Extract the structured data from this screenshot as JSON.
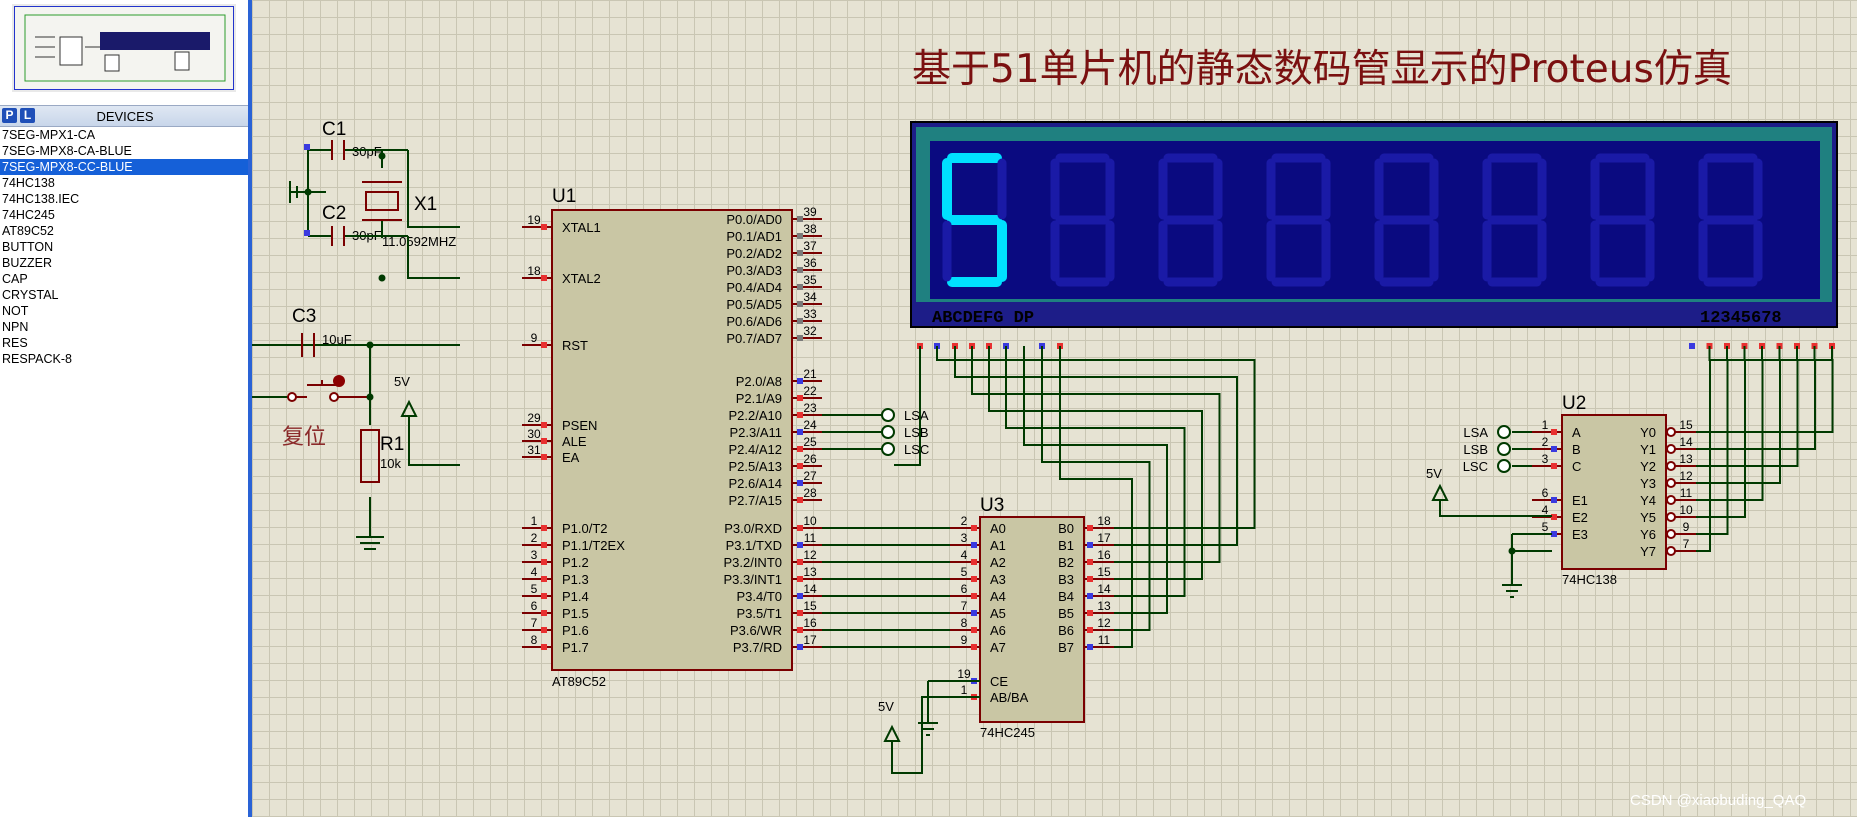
{
  "window": {
    "watermark": "CSDN @xiaobuding_QAQ"
  },
  "devices_panel": {
    "p_button": "P",
    "l_button": "L",
    "title": "DEVICES",
    "items": [
      "7SEG-MPX1-CA",
      "7SEG-MPX8-CA-BLUE",
      "7SEG-MPX8-CC-BLUE",
      "74HC138",
      "74HC138.IEC",
      "74HC245",
      "AT89C52",
      "BUTTON",
      "BUZZER",
      "CAP",
      "CRYSTAL",
      "NOT",
      "NPN",
      "RES",
      "RESPACK-8"
    ],
    "selected_index": 2
  },
  "schematic": {
    "title": "基于51单片机的静态数码管显示的Proteus仿真",
    "display": {
      "digit": "5",
      "left_pins": "ABCDEFG  DP",
      "right_pins": "12345678",
      "color": "#00e0ff"
    },
    "c1": {
      "ref": "C1",
      "value": "30pF"
    },
    "c2": {
      "ref": "C2",
      "value": "30pF"
    },
    "c3": {
      "ref": "C3",
      "value": "10uF"
    },
    "x1": {
      "ref": "X1",
      "value": "11.0592MHZ"
    },
    "r1": {
      "ref": "R1",
      "value": "10k"
    },
    "reset_label": "复位",
    "power_5v": "5V",
    "u1": {
      "ref": "U1",
      "part": "AT89C52",
      "left_pins": [
        {
          "num": "19",
          "name": "XTAL1"
        },
        {
          "num": "18",
          "name": "XTAL2"
        },
        {
          "num": "9",
          "name": "RST"
        },
        {
          "num": "29",
          "name": "PSEN"
        },
        {
          "num": "30",
          "name": "ALE"
        },
        {
          "num": "31",
          "name": "EA"
        },
        {
          "num": "1",
          "name": "P1.0/T2"
        },
        {
          "num": "2",
          "name": "P1.1/T2EX"
        },
        {
          "num": "3",
          "name": "P1.2"
        },
        {
          "num": "4",
          "name": "P1.3"
        },
        {
          "num": "5",
          "name": "P1.4"
        },
        {
          "num": "6",
          "name": "P1.5"
        },
        {
          "num": "7",
          "name": "P1.6"
        },
        {
          "num": "8",
          "name": "P1.7"
        }
      ],
      "right_pins": [
        {
          "num": "39",
          "name": "P0.0/AD0"
        },
        {
          "num": "38",
          "name": "P0.1/AD1"
        },
        {
          "num": "37",
          "name": "P0.2/AD2"
        },
        {
          "num": "36",
          "name": "P0.3/AD3"
        },
        {
          "num": "35",
          "name": "P0.4/AD4"
        },
        {
          "num": "34",
          "name": "P0.5/AD5"
        },
        {
          "num": "33",
          "name": "P0.6/AD6"
        },
        {
          "num": "32",
          "name": "P0.7/AD7"
        },
        {
          "num": "21",
          "name": "P2.0/A8"
        },
        {
          "num": "22",
          "name": "P2.1/A9"
        },
        {
          "num": "23",
          "name": "P2.2/A10"
        },
        {
          "num": "24",
          "name": "P2.3/A11"
        },
        {
          "num": "25",
          "name": "P2.4/A12"
        },
        {
          "num": "26",
          "name": "P2.5/A13"
        },
        {
          "num": "27",
          "name": "P2.6/A14"
        },
        {
          "num": "28",
          "name": "P2.7/A15"
        },
        {
          "num": "10",
          "name": "P3.0/RXD"
        },
        {
          "num": "11",
          "name": "P3.1/TXD"
        },
        {
          "num": "12",
          "name": "P3.2/INT0"
        },
        {
          "num": "13",
          "name": "P3.3/INT1"
        },
        {
          "num": "14",
          "name": "P3.4/T0"
        },
        {
          "num": "15",
          "name": "P3.5/T1"
        },
        {
          "num": "16",
          "name": "P3.6/WR"
        },
        {
          "num": "17",
          "name": "P3.7/RD"
        }
      ]
    },
    "net_labels": [
      "LSA",
      "LSB",
      "LSC"
    ],
    "u3": {
      "ref": "U3",
      "part": "74HC245",
      "a_pins": [
        {
          "num": "2",
          "name": "A0"
        },
        {
          "num": "3",
          "name": "A1"
        },
        {
          "num": "4",
          "name": "A2"
        },
        {
          "num": "5",
          "name": "A3"
        },
        {
          "num": "6",
          "name": "A4"
        },
        {
          "num": "7",
          "name": "A5"
        },
        {
          "num": "8",
          "name": "A6"
        },
        {
          "num": "9",
          "name": "A7"
        }
      ],
      "b_pins": [
        {
          "num": "18",
          "name": "B0"
        },
        {
          "num": "17",
          "name": "B1"
        },
        {
          "num": "16",
          "name": "B2"
        },
        {
          "num": "15",
          "name": "B3"
        },
        {
          "num": "14",
          "name": "B4"
        },
        {
          "num": "13",
          "name": "B5"
        },
        {
          "num": "12",
          "name": "B6"
        },
        {
          "num": "11",
          "name": "B7"
        }
      ],
      "ctrl_pins": [
        {
          "num": "19",
          "name": "CE"
        },
        {
          "num": "1",
          "name": "AB/BA"
        }
      ]
    },
    "u2": {
      "ref": "U2",
      "part": "74HC138",
      "in_pins": [
        {
          "num": "1",
          "name": "A"
        },
        {
          "num": "2",
          "name": "B"
        },
        {
          "num": "3",
          "name": "C"
        },
        {
          "num": "6",
          "name": "E1"
        },
        {
          "num": "4",
          "name": "E2"
        },
        {
          "num": "5",
          "name": "E3"
        }
      ],
      "out_pins": [
        {
          "num": "15",
          "name": "Y0"
        },
        {
          "num": "14",
          "name": "Y1"
        },
        {
          "num": "13",
          "name": "Y2"
        },
        {
          "num": "12",
          "name": "Y3"
        },
        {
          "num": "11",
          "name": "Y4"
        },
        {
          "num": "10",
          "name": "Y5"
        },
        {
          "num": "9",
          "name": "Y6"
        },
        {
          "num": "7",
          "name": "Y7"
        }
      ]
    }
  }
}
